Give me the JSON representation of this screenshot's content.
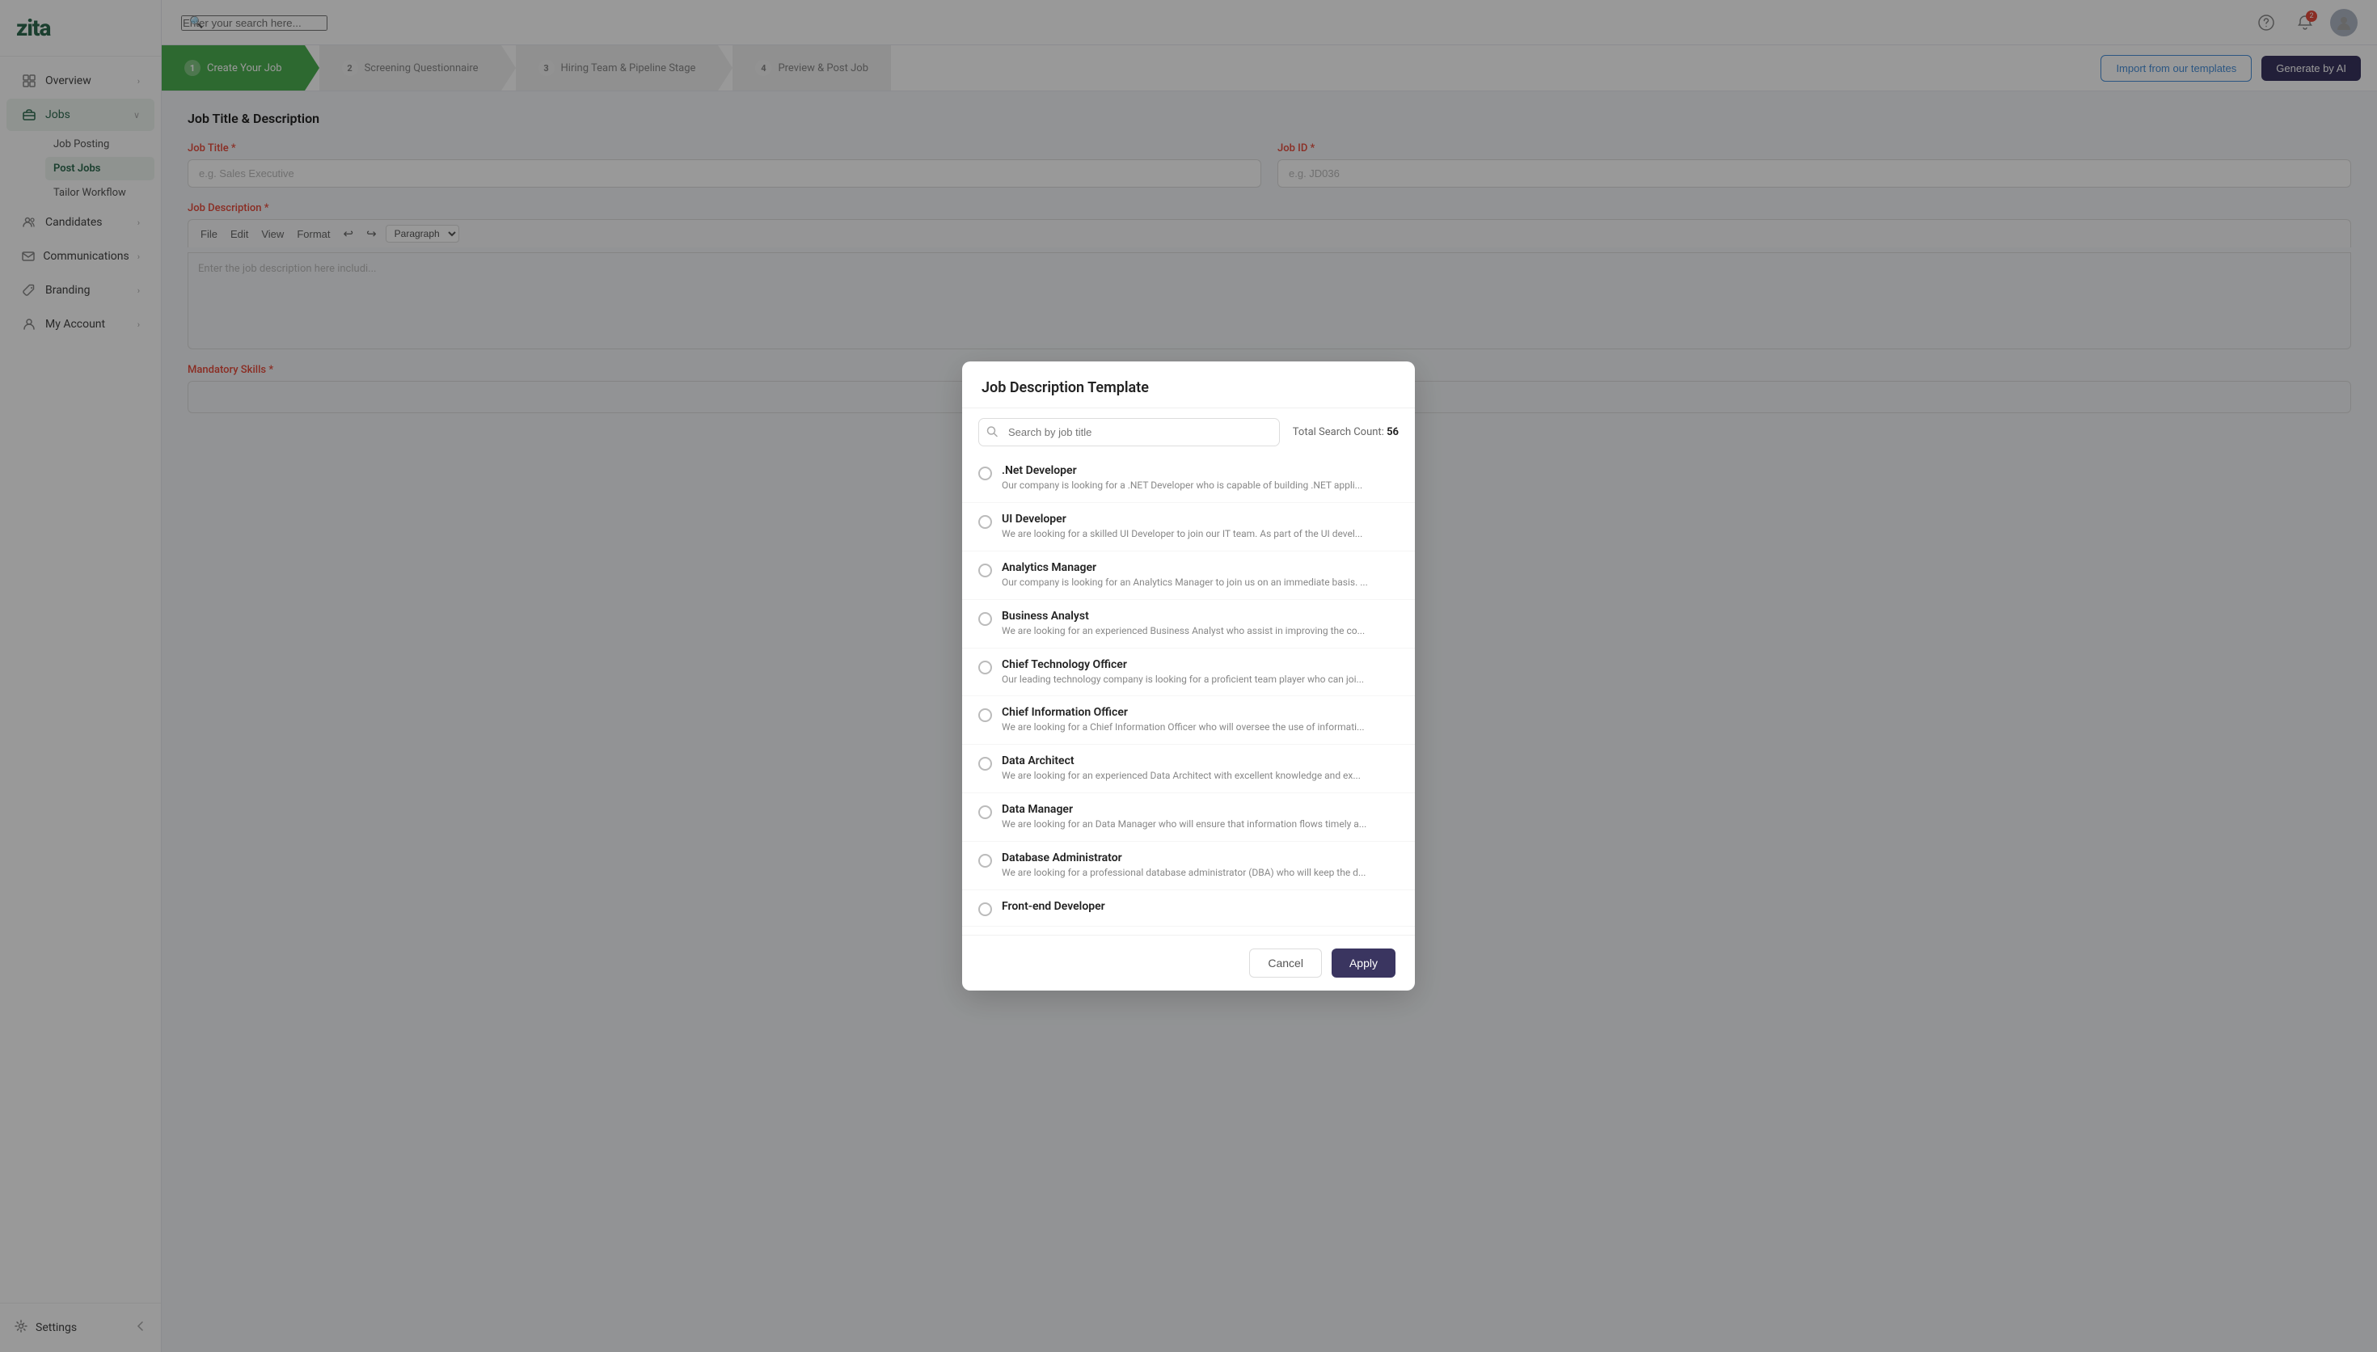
{
  "app": {
    "logo": "zita",
    "search_placeholder": "Enter your search here..."
  },
  "sidebar": {
    "items": [
      {
        "id": "overview",
        "label": "Overview",
        "icon": "grid"
      },
      {
        "id": "jobs",
        "label": "Jobs",
        "icon": "briefcase",
        "expanded": true
      },
      {
        "id": "candidates",
        "label": "Candidates",
        "icon": "users"
      },
      {
        "id": "communications",
        "label": "Communications",
        "icon": "mail"
      },
      {
        "id": "branding",
        "label": "Branding",
        "icon": "tag"
      },
      {
        "id": "my-account",
        "label": "My Account",
        "icon": "user"
      }
    ],
    "jobs_sub": [
      {
        "id": "job-posting",
        "label": "Job Posting"
      },
      {
        "id": "post-jobs",
        "label": "Post Jobs",
        "active": true
      },
      {
        "id": "tailor-workflow",
        "label": "Tailor Workflow"
      }
    ],
    "settings": "Settings"
  },
  "topnav": {
    "notification_count": "2"
  },
  "stepper": {
    "steps": [
      {
        "num": "1",
        "label": "Create Your Job",
        "state": "active"
      },
      {
        "num": "2",
        "label": "Screening Questionnaire",
        "state": "pending"
      },
      {
        "num": "3",
        "label": "Hiring Team & Pipeline Stage",
        "state": "pending"
      },
      {
        "num": "4",
        "label": "Preview & Post Job",
        "state": "pending"
      }
    ],
    "import_btn": "Import from our templates",
    "generate_btn": "Generate by AI"
  },
  "form": {
    "section_title": "Job Title & Description",
    "job_title_label": "Job Title",
    "job_title_placeholder": "e.g. Sales Executive",
    "job_description_label": "Job Description",
    "job_description_placeholder": "Enter the job description here includi...",
    "job_id_label": "Job ID",
    "job_id_placeholder": "e.g. JD036",
    "mandatory_skills_label": "Mandatory Skills",
    "editor_paragraph": "Paragraph",
    "editor_menu": [
      "File",
      "Edit",
      "View",
      "Format"
    ]
  },
  "modal": {
    "title": "Job Description Template",
    "search_placeholder": "Search by job title",
    "search_count_label": "Total Search Count:",
    "search_count": "56",
    "items": [
      {
        "id": "net-developer",
        "title": ".Net Developer",
        "desc": "Our company is looking for a .NET Developer who is capable of building .NET appli..."
      },
      {
        "id": "ui-developer",
        "title": "UI Developer",
        "desc": "We are looking for a skilled UI Developer to join our IT team. As part of the UI devel..."
      },
      {
        "id": "analytics-manager",
        "title": "Analytics Manager",
        "desc": "Our company is looking for an Analytics Manager to join us on an immediate basis. ..."
      },
      {
        "id": "business-analyst",
        "title": "Business Analyst",
        "desc": "We are looking for an experienced Business Analyst who assist in improving the co..."
      },
      {
        "id": "cto",
        "title": "Chief Technology Officer",
        "desc": "Our leading technology company is looking for a proficient team player who can joi..."
      },
      {
        "id": "cio",
        "title": "Chief Information Officer",
        "desc": "We are looking for a Chief Information Officer who will oversee the use of informati..."
      },
      {
        "id": "data-architect",
        "title": "Data Architect",
        "desc": "We are looking for an experienced Data Architect with excellent knowledge and ex..."
      },
      {
        "id": "data-manager",
        "title": "Data Manager",
        "desc": "We are looking for an Data Manager who will ensure that information flows timely a..."
      },
      {
        "id": "database-admin",
        "title": "Database Administrator",
        "desc": "We are looking for a professional database administrator (DBA) who will keep the d..."
      },
      {
        "id": "frontend-dev",
        "title": "Front-end Developer",
        "desc": ""
      }
    ],
    "cancel_btn": "Cancel",
    "apply_btn": "Apply"
  }
}
